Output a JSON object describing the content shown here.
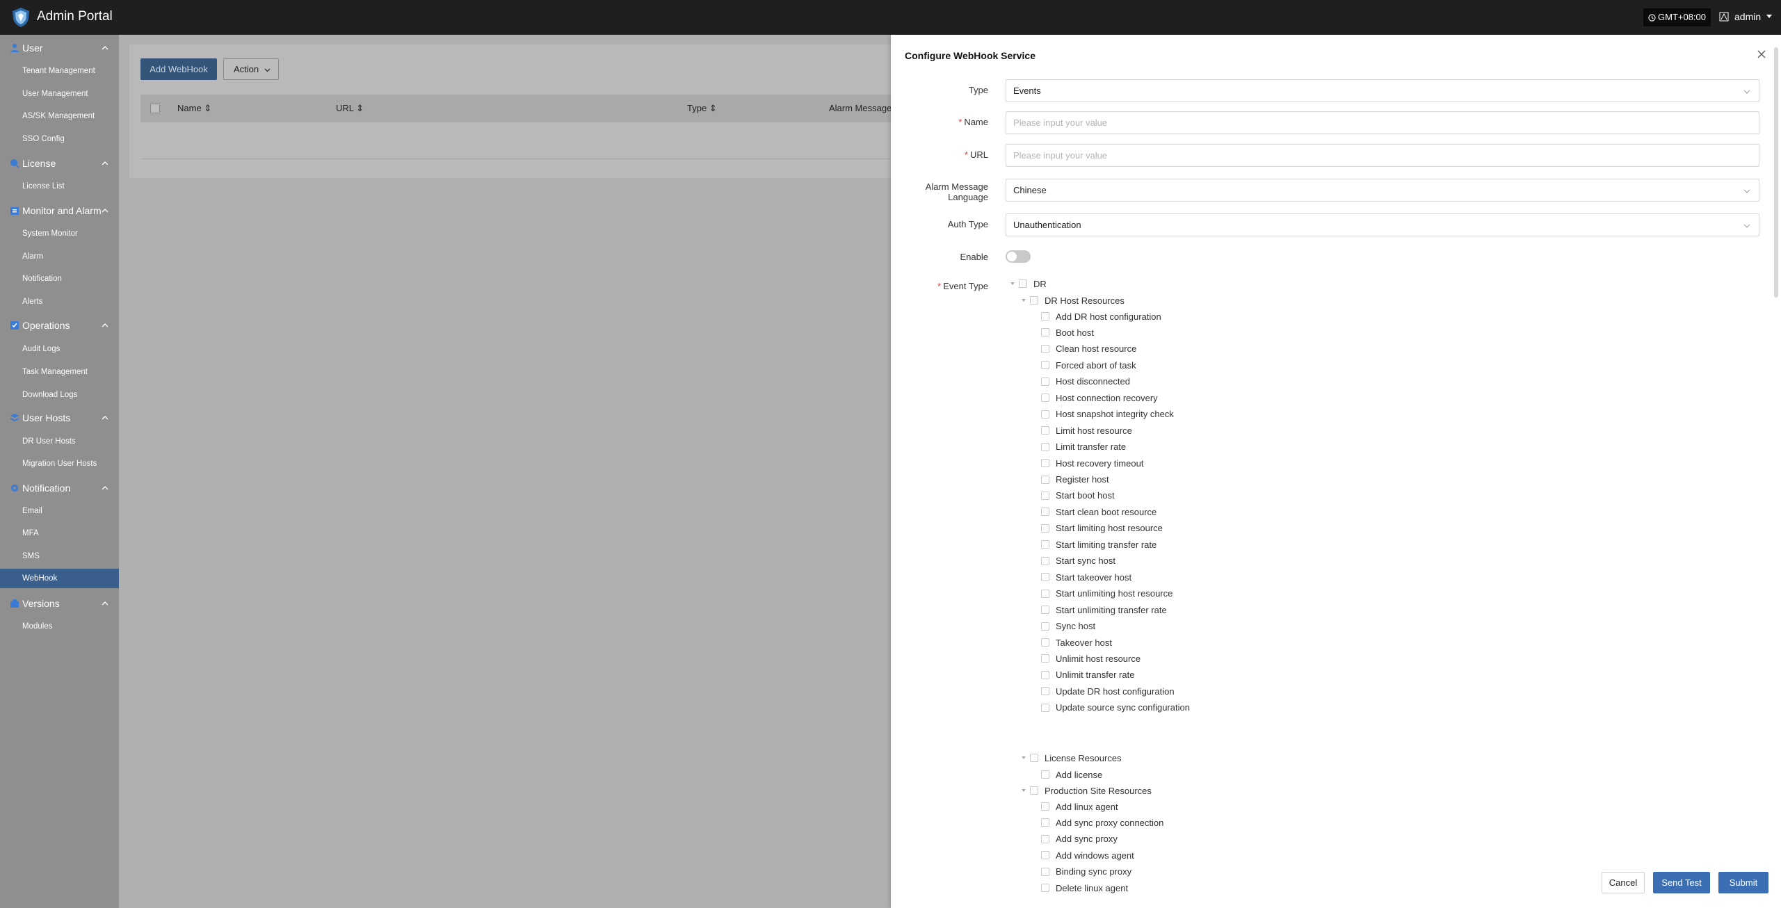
{
  "app": {
    "title": "Admin Portal",
    "timezone": "GMT+08:00",
    "user": "admin"
  },
  "sidebar": {
    "groups": [
      {
        "label": "User",
        "icon": "user-icon",
        "items": [
          "Tenant Management",
          "User Management",
          "AS/SK Management",
          "SSO Config"
        ]
      },
      {
        "label": "License",
        "icon": "license-icon",
        "items": [
          "License List"
        ]
      },
      {
        "label": "Monitor and Alarm",
        "icon": "monitor-icon",
        "items": [
          "System Monitor",
          "Alarm",
          "Notification",
          "Alerts"
        ]
      },
      {
        "label": "Operations",
        "icon": "operations-icon",
        "items": [
          "Audit Logs",
          "Task Management",
          "Download Logs"
        ]
      },
      {
        "label": "User Hosts",
        "icon": "layers-icon",
        "items": [
          "DR User Hosts",
          "Migration User Hosts"
        ]
      },
      {
        "label": "Notification",
        "icon": "gear-icon",
        "items": [
          "Email",
          "MFA",
          "SMS",
          "WebHook"
        ]
      },
      {
        "label": "Versions",
        "icon": "package-icon",
        "items": [
          "Modules"
        ]
      }
    ],
    "active_item": "WebHook"
  },
  "page": {
    "add_button": "Add WebHook",
    "action_button": "Action",
    "columns": [
      "Name",
      "URL",
      "Type",
      "Alarm Message"
    ]
  },
  "drawer": {
    "title": "Configure WebHook Service",
    "type_label": "Type",
    "type_value": "Events",
    "name_label": "Name",
    "name_placeholder": "Please input your value",
    "url_label": "URL",
    "url_placeholder": "Please input your value",
    "lang_label_line1": "Alarm Message",
    "lang_label_line2": "Language",
    "lang_value": "Chinese",
    "auth_label": "Auth Type",
    "auth_value": "Unauthentication",
    "enable_label": "Enable",
    "enable_value": false,
    "event_type_label": "Event Type",
    "tree": {
      "root": "DR",
      "groups": [
        {
          "label": "DR Host Resources",
          "items": [
            "Add DR host configuration",
            "Boot host",
            "Clean host resource",
            "Forced abort of task",
            "Host disconnected",
            "Host connection recovery",
            "Host snapshot integrity check",
            "Limit host resource",
            "Limit transfer rate",
            "Host recovery timeout",
            "Register host",
            "Start boot host",
            "Start clean boot resource",
            "Start limiting host resource",
            "Start limiting transfer rate",
            "Start sync host",
            "Start takeover host",
            "Start unlimiting host resource",
            "Start unlimiting transfer rate",
            "Sync host",
            "Takeover host",
            "Unlimit host resource",
            "Unlimit transfer rate",
            "Update DR host configuration",
            "Update source sync configuration"
          ]
        },
        {
          "label": "License Resources",
          "items": [
            "Add license"
          ]
        },
        {
          "label": "Production Site Resources",
          "items": [
            "Add linux agent",
            "Add sync proxy connection",
            "Add sync proxy",
            "Add windows agent",
            "Binding sync proxy",
            "Delete linux agent"
          ]
        }
      ]
    },
    "buttons": {
      "cancel": "Cancel",
      "send_test": "Send Test",
      "submit": "Submit"
    }
  }
}
